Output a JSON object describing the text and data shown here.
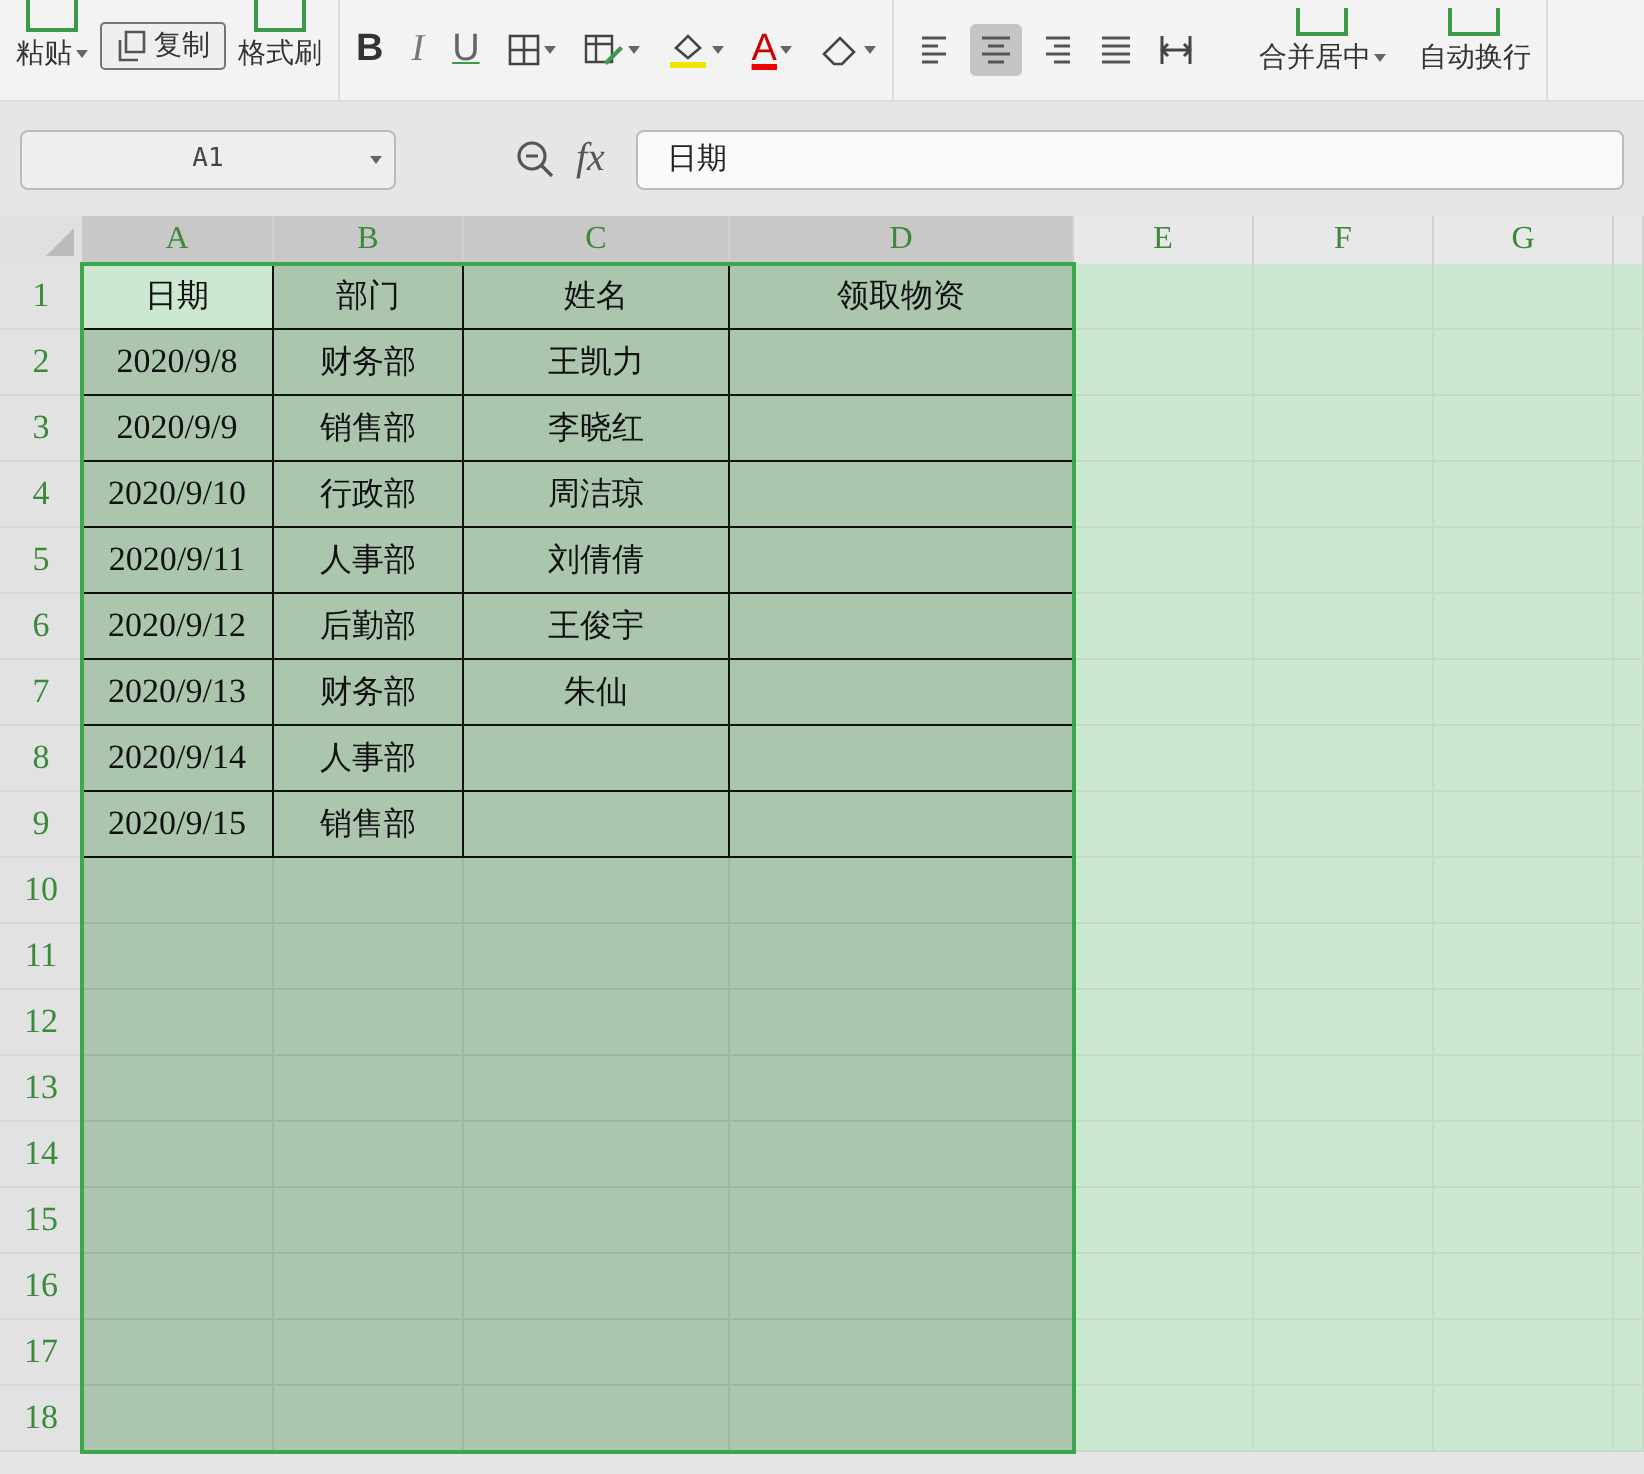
{
  "toolbar": {
    "clipboard": [
      {
        "kind": "paste",
        "label": "粘贴",
        "dropdown": true
      },
      {
        "kind": "copy",
        "label": "复制",
        "dropdown": false
      },
      {
        "kind": "painter",
        "label": "格式刷",
        "dropdown": false
      }
    ],
    "font_tools": [
      {
        "kind": "bold",
        "label": "B"
      },
      {
        "kind": "italic",
        "label": "I"
      },
      {
        "kind": "underline",
        "label": "U"
      },
      {
        "kind": "borders",
        "dropdown": true
      },
      {
        "kind": "cellstyle",
        "dropdown": true
      },
      {
        "kind": "fill",
        "dropdown": true
      },
      {
        "kind": "fontcolor",
        "label": "A",
        "dropdown": true
      },
      {
        "kind": "eraser",
        "dropdown": true
      }
    ],
    "align_tools": [
      {
        "kind": "left",
        "selected": false
      },
      {
        "kind": "center",
        "selected": true
      },
      {
        "kind": "right",
        "selected": false
      },
      {
        "kind": "justify",
        "selected": false
      },
      {
        "kind": "distributed",
        "selected": false
      }
    ],
    "merge": {
      "label": "合并居中",
      "dropdown": true
    },
    "wrap": {
      "label": "自动换行"
    }
  },
  "formula_bar": {
    "name_box": "A1",
    "fx": "fx",
    "value": "日期"
  },
  "sheet": {
    "columns": [
      {
        "label": "A",
        "selected": true
      },
      {
        "label": "B",
        "selected": true
      },
      {
        "label": "C",
        "selected": true
      },
      {
        "label": "D",
        "selected": true
      },
      {
        "label": "E",
        "selected": false
      },
      {
        "label": "F",
        "selected": false
      },
      {
        "label": "G",
        "selected": false
      }
    ],
    "rows": [
      {
        "label": "1",
        "selected": true,
        "bordered": true,
        "cells": [
          {
            "text": "日期",
            "active": true
          },
          {
            "text": "部门",
            "active": false
          },
          {
            "text": "姓名",
            "active": false
          },
          {
            "text": "领取物资",
            "active": false
          }
        ]
      },
      {
        "label": "2",
        "selected": true,
        "bordered": true,
        "cells": [
          {
            "text": "2020/9/8",
            "active": false
          },
          {
            "text": "财务部",
            "active": false
          },
          {
            "text": "王凯力",
            "active": false
          },
          {
            "active": false
          }
        ]
      },
      {
        "label": "3",
        "selected": true,
        "bordered": true,
        "cells": [
          {
            "text": "2020/9/9",
            "active": false
          },
          {
            "text": "销售部",
            "active": false
          },
          {
            "text": "李晓红",
            "active": false
          },
          {
            "active": false
          }
        ]
      },
      {
        "label": "4",
        "selected": true,
        "bordered": true,
        "cells": [
          {
            "text": "2020/9/10",
            "active": false
          },
          {
            "text": "行政部",
            "active": false
          },
          {
            "text": "周洁琼",
            "active": false
          },
          {
            "active": false
          }
        ]
      },
      {
        "label": "5",
        "selected": true,
        "bordered": true,
        "cells": [
          {
            "text": "2020/9/11",
            "active": false
          },
          {
            "text": "人事部",
            "active": false
          },
          {
            "text": "刘倩倩",
            "active": false
          },
          {
            "active": false
          }
        ]
      },
      {
        "label": "6",
        "selected": true,
        "bordered": true,
        "cells": [
          {
            "text": "2020/9/12",
            "active": false
          },
          {
            "text": "后勤部",
            "active": false
          },
          {
            "text": "王俊宇",
            "active": false
          },
          {
            "active": false
          }
        ]
      },
      {
        "label": "7",
        "selected": true,
        "bordered": true,
        "cells": [
          {
            "text": "2020/9/13",
            "active": false
          },
          {
            "text": "财务部",
            "active": false
          },
          {
            "text": "朱仙",
            "active": false
          },
          {
            "active": false
          }
        ]
      },
      {
        "label": "8",
        "selected": true,
        "bordered": true,
        "cells": [
          {
            "text": "2020/9/14",
            "active": false
          },
          {
            "text": "人事部",
            "active": false
          },
          {
            "active": false
          },
          {
            "active": false
          }
        ]
      },
      {
        "label": "9",
        "selected": true,
        "bordered": true,
        "cells": [
          {
            "text": "2020/9/15",
            "active": false
          },
          {
            "text": "销售部",
            "active": false
          },
          {
            "active": false
          },
          {
            "active": false
          }
        ]
      },
      {
        "label": "10",
        "selected": true,
        "bordered": false
      },
      {
        "label": "11",
        "selected": true,
        "bordered": false
      },
      {
        "label": "12",
        "selected": true,
        "bordered": false
      },
      {
        "label": "13",
        "selected": true,
        "bordered": false
      },
      {
        "label": "14",
        "selected": true,
        "bordered": false
      },
      {
        "label": "15",
        "selected": true,
        "bordered": false
      },
      {
        "label": "16",
        "selected": true,
        "bordered": false
      },
      {
        "label": "17",
        "selected": true,
        "bordered": false
      },
      {
        "label": "18",
        "selected": true,
        "bordered": false
      }
    ]
  }
}
